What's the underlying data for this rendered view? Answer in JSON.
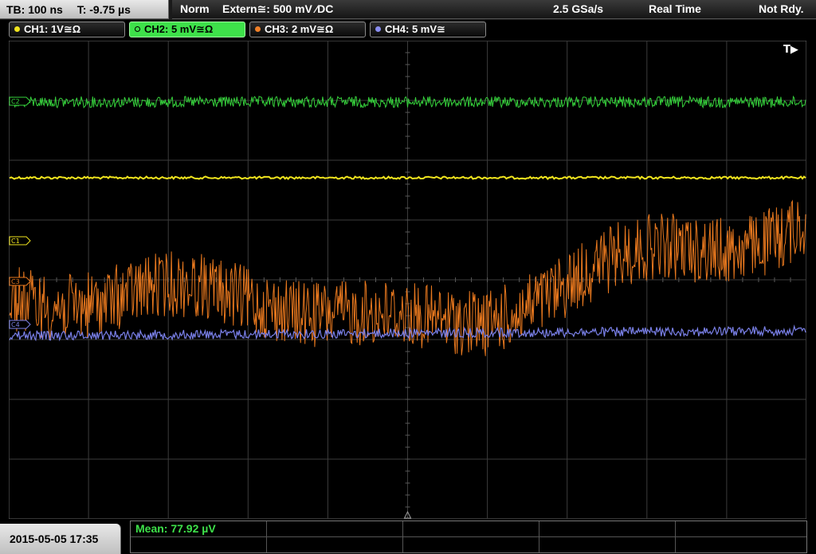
{
  "header": {
    "timebase": "TB: 100 ns",
    "trigger_time": "T: -9.75 µs",
    "trigger_mode": "Norm",
    "trigger_source": "Extern≅: 500 mV ⁄DC",
    "sample_rate": "2.5 GSa/s",
    "acquisition_mode": "Real Time",
    "status": "Not Rdy."
  },
  "channels": [
    {
      "label": "CH1: 1V≅Ω",
      "color": "#f0e41e",
      "active": false
    },
    {
      "label": "CH2: 5 mV≅Ω",
      "color": "#36d23c",
      "active": true
    },
    {
      "label": "CH3: 2 mV≅Ω",
      "color": "#f08028",
      "active": false
    },
    {
      "label": "CH4: 5 mV≅",
      "color": "#8a8ef0",
      "active": false
    }
  ],
  "markers": {
    "trigger_position": "T▶",
    "c1": "C1",
    "c2": "C2",
    "c3": "C3",
    "c4": "C4"
  },
  "colors": {
    "grid": "#3c3c3c",
    "ch1": "#f0e41e",
    "ch2": "#36d23c",
    "ch3": "#e8781e",
    "ch4": "#7a80e8"
  },
  "footer": {
    "datetime": "2015-05-05 17:35",
    "measurement": "Mean: 77.92 µV"
  }
}
